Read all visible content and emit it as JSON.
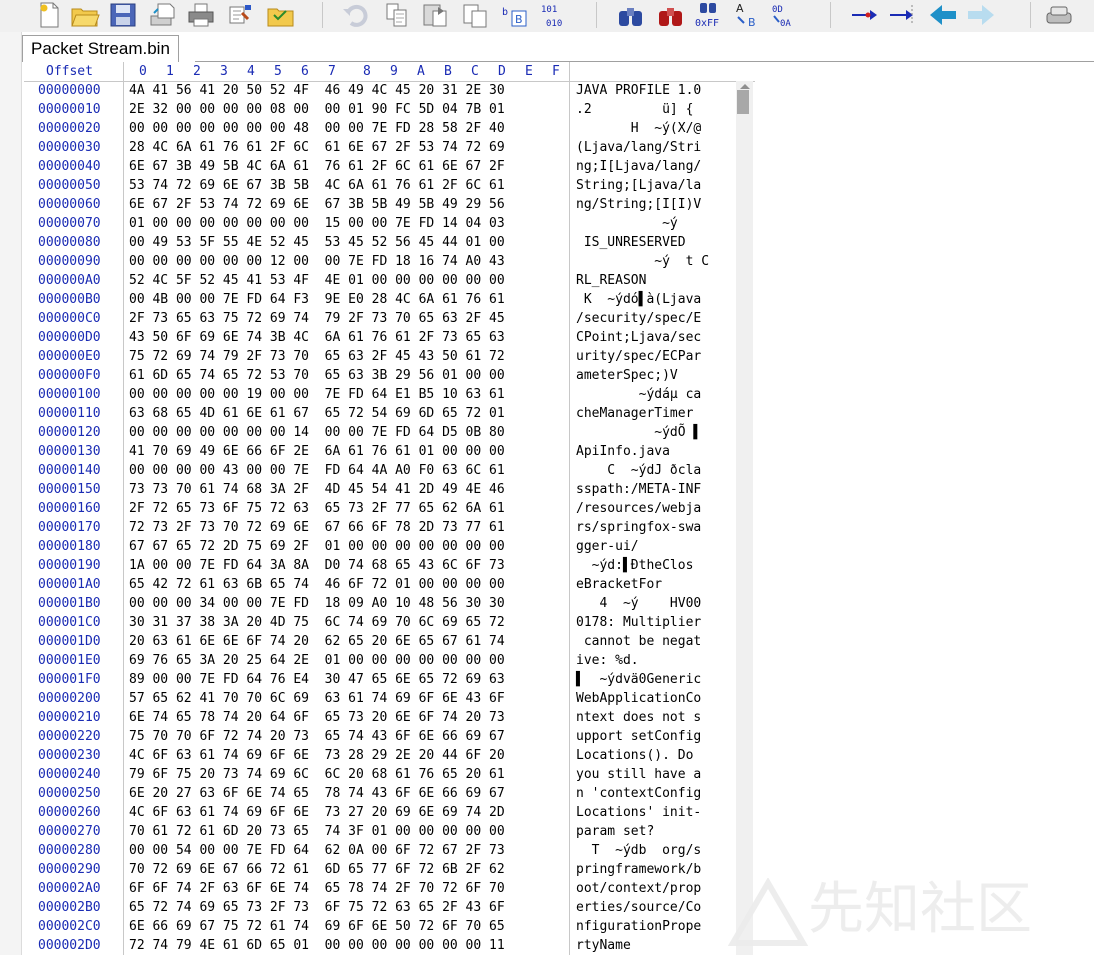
{
  "toolbar": {
    "icons": [
      "new-file",
      "open-folder",
      "save",
      "save-copy",
      "print",
      "properties",
      "open-all",
      "undo",
      "copy",
      "paste",
      "paste-insert",
      "edit-bytes",
      "convert",
      "replace-hex",
      "find",
      "find-replace",
      "find-ascii",
      "find-text",
      "goto",
      "goto-next",
      "back",
      "forward",
      "disk"
    ],
    "colors": {
      "accent": "#1a2bb4",
      "arrow_blue": "#1e90c8"
    }
  },
  "tab": {
    "title": "Packet Stream.bin"
  },
  "editor": {
    "header": {
      "offset_label": "Offset",
      "columns": [
        "0",
        "1",
        "2",
        "3",
        "4",
        "5",
        "6",
        "7",
        "8",
        "9",
        "A",
        "B",
        "C",
        "D",
        "E",
        "F"
      ]
    },
    "rows": [
      {
        "offset": "00000000",
        "hex": "4A 41 56 41 20 50 52 4F  46 49 4C 45 20 31 2E 30",
        "ascii": "JAVA PROFILE 1.0"
      },
      {
        "offset": "00000010",
        "hex": "2E 32 00 00 00 00 08 00  00 01 90 FC 5D 04 7B 01",
        "ascii": ".2         ü] {"
      },
      {
        "offset": "00000020",
        "hex": "00 00 00 00 00 00 00 48  00 00 7E FD 28 58 2F 40",
        "ascii": "       H  ~ý(X/@"
      },
      {
        "offset": "00000030",
        "hex": "28 4C 6A 61 76 61 2F 6C  61 6E 67 2F 53 74 72 69",
        "ascii": "(Ljava/lang/Stri"
      },
      {
        "offset": "00000040",
        "hex": "6E 67 3B 49 5B 4C 6A 61  76 61 2F 6C 61 6E 67 2F",
        "ascii": "ng;I[Ljava/lang/"
      },
      {
        "offset": "00000050",
        "hex": "53 74 72 69 6E 67 3B 5B  4C 6A 61 76 61 2F 6C 61",
        "ascii": "String;[Ljava/la"
      },
      {
        "offset": "00000060",
        "hex": "6E 67 2F 53 74 72 69 6E  67 3B 5B 49 5B 49 29 56",
        "ascii": "ng/String;[I[I)V"
      },
      {
        "offset": "00000070",
        "hex": "01 00 00 00 00 00 00 00  15 00 00 7E FD 14 04 03",
        "ascii": "           ~ý"
      },
      {
        "offset": "00000080",
        "hex": "00 49 53 5F 55 4E 52 45  53 45 52 56 45 44 01 00",
        "ascii": " IS_UNRESERVED"
      },
      {
        "offset": "00000090",
        "hex": "00 00 00 00 00 00 12 00  00 7E FD 18 16 74 A0 43",
        "ascii": "          ~ý  t C"
      },
      {
        "offset": "000000A0",
        "hex": "52 4C 5F 52 45 41 53 4F  4E 01 00 00 00 00 00 00",
        "ascii": "RL_REASON"
      },
      {
        "offset": "000000B0",
        "hex": "00 4B 00 00 7E FD 64 F3  9E E0 28 4C 6A 61 76 61",
        "ascii": " K  ~ýdó▌à(Ljava"
      },
      {
        "offset": "000000C0",
        "hex": "2F 73 65 63 75 72 69 74  79 2F 73 70 65 63 2F 45",
        "ascii": "/security/spec/E"
      },
      {
        "offset": "000000D0",
        "hex": "43 50 6F 69 6E 74 3B 4C  6A 61 76 61 2F 73 65 63",
        "ascii": "CPoint;Ljava/sec"
      },
      {
        "offset": "000000E0",
        "hex": "75 72 69 74 79 2F 73 70  65 63 2F 45 43 50 61 72",
        "ascii": "urity/spec/ECPar"
      },
      {
        "offset": "000000F0",
        "hex": "61 6D 65 74 65 72 53 70  65 63 3B 29 56 01 00 00",
        "ascii": "ameterSpec;)V"
      },
      {
        "offset": "00000100",
        "hex": "00 00 00 00 00 19 00 00  7E FD 64 E1 B5 10 63 61",
        "ascii": "        ~ýdáµ ca"
      },
      {
        "offset": "00000110",
        "hex": "63 68 65 4D 61 6E 61 67  65 72 54 69 6D 65 72 01",
        "ascii": "cheManagerTimer"
      },
      {
        "offset": "00000120",
        "hex": "00 00 00 00 00 00 00 14  00 00 7E FD 64 D5 0B 80",
        "ascii": "          ~ýdÕ ▌"
      },
      {
        "offset": "00000130",
        "hex": "41 70 69 49 6E 66 6F 2E  6A 61 76 61 01 00 00 00",
        "ascii": "ApiInfo.java"
      },
      {
        "offset": "00000140",
        "hex": "00 00 00 00 43 00 00 7E  FD 64 4A A0 F0 63 6C 61",
        "ascii": "    C  ~ýdJ ðcla"
      },
      {
        "offset": "00000150",
        "hex": "73 73 70 61 74 68 3A 2F  4D 45 54 41 2D 49 4E 46",
        "ascii": "sspath:/META-INF"
      },
      {
        "offset": "00000160",
        "hex": "2F 72 65 73 6F 75 72 63  65 73 2F 77 65 62 6A 61",
        "ascii": "/resources/webja"
      },
      {
        "offset": "00000170",
        "hex": "72 73 2F 73 70 72 69 6E  67 66 6F 78 2D 73 77 61",
        "ascii": "rs/springfox-swa"
      },
      {
        "offset": "00000180",
        "hex": "67 67 65 72 2D 75 69 2F  01 00 00 00 00 00 00 00",
        "ascii": "gger-ui/"
      },
      {
        "offset": "00000190",
        "hex": "1A 00 00 7E FD 64 3A 8A  D0 74 68 65 43 6C 6F 73",
        "ascii": "  ~ýd:▌ÐtheClos"
      },
      {
        "offset": "000001A0",
        "hex": "65 42 72 61 63 6B 65 74  46 6F 72 01 00 00 00 00",
        "ascii": "eBracketFor"
      },
      {
        "offset": "000001B0",
        "hex": "00 00 00 34 00 00 7E FD  18 09 A0 10 48 56 30 30",
        "ascii": "   4  ~ý    HV00"
      },
      {
        "offset": "000001C0",
        "hex": "30 31 37 38 3A 20 4D 75  6C 74 69 70 6C 69 65 72",
        "ascii": "0178: Multiplier"
      },
      {
        "offset": "000001D0",
        "hex": "20 63 61 6E 6E 6F 74 20  62 65 20 6E 65 67 61 74",
        "ascii": " cannot be negat"
      },
      {
        "offset": "000001E0",
        "hex": "69 76 65 3A 20 25 64 2E  01 00 00 00 00 00 00 00",
        "ascii": "ive: %d."
      },
      {
        "offset": "000001F0",
        "hex": "89 00 00 7E FD 64 76 E4  30 47 65 6E 65 72 69 63",
        "ascii": "▌  ~ýdvä0Generic"
      },
      {
        "offset": "00000200",
        "hex": "57 65 62 41 70 70 6C 69  63 61 74 69 6F 6E 43 6F",
        "ascii": "WebApplicationCo"
      },
      {
        "offset": "00000210",
        "hex": "6E 74 65 78 74 20 64 6F  65 73 20 6E 6F 74 20 73",
        "ascii": "ntext does not s"
      },
      {
        "offset": "00000220",
        "hex": "75 70 70 6F 72 74 20 73  65 74 43 6F 6E 66 69 67",
        "ascii": "upport setConfig"
      },
      {
        "offset": "00000230",
        "hex": "4C 6F 63 61 74 69 6F 6E  73 28 29 2E 20 44 6F 20",
        "ascii": "Locations(). Do "
      },
      {
        "offset": "00000240",
        "hex": "79 6F 75 20 73 74 69 6C  6C 20 68 61 76 65 20 61",
        "ascii": "you still have a"
      },
      {
        "offset": "00000250",
        "hex": "6E 20 27 63 6F 6E 74 65  78 74 43 6F 6E 66 69 67",
        "ascii": "n 'contextConfig"
      },
      {
        "offset": "00000260",
        "hex": "4C 6F 63 61 74 69 6F 6E  73 27 20 69 6E 69 74 2D",
        "ascii": "Locations' init-"
      },
      {
        "offset": "00000270",
        "hex": "70 61 72 61 6D 20 73 65  74 3F 01 00 00 00 00 00",
        "ascii": "param set?"
      },
      {
        "offset": "00000280",
        "hex": "00 00 54 00 00 7E FD 64  62 0A 00 6F 72 67 2F 73",
        "ascii": "  T  ~ýdb  org/s"
      },
      {
        "offset": "00000290",
        "hex": "70 72 69 6E 67 66 72 61  6D 65 77 6F 72 6B 2F 62",
        "ascii": "pringframework/b"
      },
      {
        "offset": "000002A0",
        "hex": "6F 6F 74 2F 63 6F 6E 74  65 78 74 2F 70 72 6F 70",
        "ascii": "oot/context/prop"
      },
      {
        "offset": "000002B0",
        "hex": "65 72 74 69 65 73 2F 73  6F 75 72 63 65 2F 43 6F",
        "ascii": "erties/source/Co"
      },
      {
        "offset": "000002C0",
        "hex": "6E 66 69 67 75 72 61 74  69 6F 6E 50 72 6F 70 65",
        "ascii": "nfigurationPrope"
      },
      {
        "offset": "000002D0",
        "hex": "72 74 79 4E 61 6D 65 01  00 00 00 00 00 00 00 11",
        "ascii": "rtyName"
      }
    ]
  },
  "watermark": {
    "text": "先知社区"
  }
}
